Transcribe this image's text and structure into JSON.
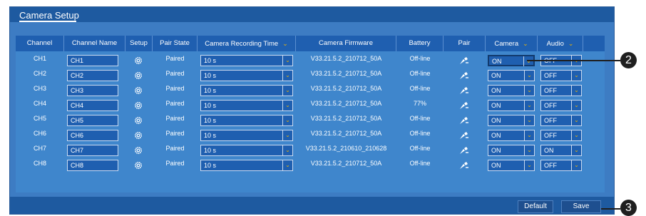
{
  "tab_label": "Camera Setup",
  "columns": [
    {
      "label": "Channel",
      "dropdown": false
    },
    {
      "label": "Channel Name",
      "dropdown": false
    },
    {
      "label": "Setup",
      "dropdown": false
    },
    {
      "label": "Pair State",
      "dropdown": false
    },
    {
      "label": "Camera Recording Time",
      "dropdown": true
    },
    {
      "label": "Camera Firmware",
      "dropdown": false
    },
    {
      "label": "Battery",
      "dropdown": false
    },
    {
      "label": "Pair",
      "dropdown": false
    },
    {
      "label": "Camera",
      "dropdown": true
    },
    {
      "label": "Audio",
      "dropdown": true
    }
  ],
  "rows": [
    {
      "channel": "CH1",
      "name": "CH1",
      "pair_state": "Paired",
      "rec_time": "10 s",
      "firmware": "V33.21.5.2_210712_50A",
      "battery": "Off-line",
      "camera": "ON",
      "audio": "OFF"
    },
    {
      "channel": "CH2",
      "name": "CH2",
      "pair_state": "Paired",
      "rec_time": "10 s",
      "firmware": "V33.21.5.2_210712_50A",
      "battery": "Off-line",
      "camera": "ON",
      "audio": "OFF"
    },
    {
      "channel": "CH3",
      "name": "CH3",
      "pair_state": "Paired",
      "rec_time": "10 s",
      "firmware": "V33.21.5.2_210712_50A",
      "battery": "Off-line",
      "camera": "ON",
      "audio": "OFF"
    },
    {
      "channel": "CH4",
      "name": "CH4",
      "pair_state": "Paired",
      "rec_time": "10 s",
      "firmware": "V33.21.5.2_210712_50A",
      "battery": "77%",
      "camera": "ON",
      "audio": "OFF"
    },
    {
      "channel": "CH5",
      "name": "CH5",
      "pair_state": "Paired",
      "rec_time": "10 s",
      "firmware": "V33.21.5.2_210712_50A",
      "battery": "Off-line",
      "camera": "ON",
      "audio": "OFF"
    },
    {
      "channel": "CH6",
      "name": "CH6",
      "pair_state": "Paired",
      "rec_time": "10 s",
      "firmware": "V33.21.5.2_210712_50A",
      "battery": "Off-line",
      "camera": "ON",
      "audio": "OFF"
    },
    {
      "channel": "CH7",
      "name": "CH7",
      "pair_state": "Paired",
      "rec_time": "10 s",
      "firmware": "V33.21.5.2_210610_210628",
      "battery": "Off-line",
      "camera": "ON",
      "audio": "ON"
    },
    {
      "channel": "CH8",
      "name": "CH8",
      "pair_state": "Paired",
      "rec_time": "10 s",
      "firmware": "V33.21.5.2_210712_50A",
      "battery": "Off-line",
      "camera": "ON",
      "audio": "OFF"
    }
  ],
  "buttons": {
    "default": "Default",
    "save": "Save"
  },
  "callouts": {
    "c2": "2",
    "c3": "3"
  },
  "icons": {
    "setup": "gear-icon",
    "pair": "pair-wand-icon",
    "dropdown": "chevron-down-icon"
  },
  "colors": {
    "accent": "#f0b400",
    "panel": "#3d7cc3",
    "header": "#1f5fb0"
  }
}
